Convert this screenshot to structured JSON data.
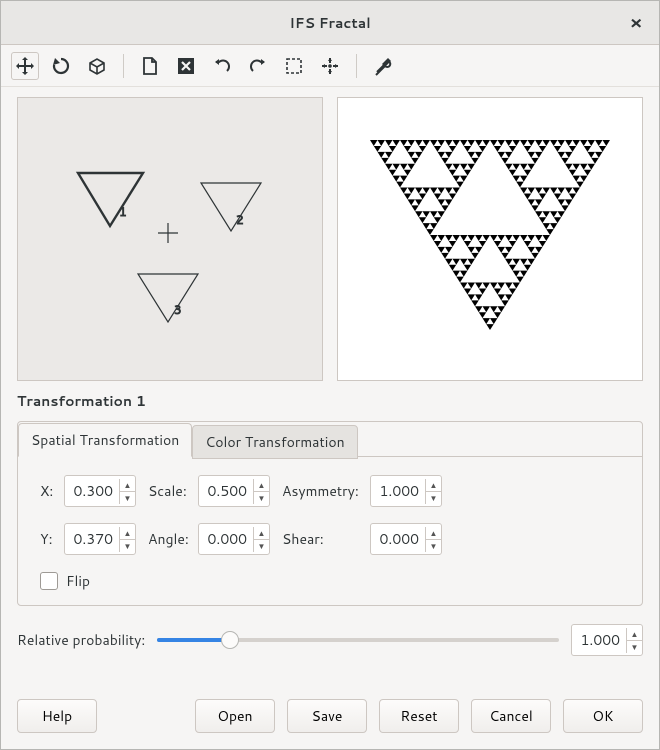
{
  "window": {
    "title": "IFS Fractal"
  },
  "section": {
    "title": "Transformation 1"
  },
  "tabs": {
    "spatial": "Spatial Transformation",
    "color": "Color Transformation"
  },
  "fields": {
    "x_label": "X:",
    "x": "0.300",
    "y_label": "Y:",
    "y": "0.370",
    "scale_label": "Scale:",
    "scale": "0.500",
    "angle_label": "Angle:",
    "angle": "0.000",
    "asym_label": "Asymmetry:",
    "asym": "1.000",
    "shear_label": "Shear:",
    "shear": "0.000",
    "flip_label": "Flip"
  },
  "slider": {
    "label": "Relative probability:",
    "value": "1.000"
  },
  "buttons": {
    "help": "Help",
    "open": "Open",
    "save": "Save",
    "reset": "Reset",
    "cancel": "Cancel",
    "ok": "OK"
  },
  "edit_tri": {
    "t1": "1",
    "t2": "2",
    "t3": "3"
  }
}
